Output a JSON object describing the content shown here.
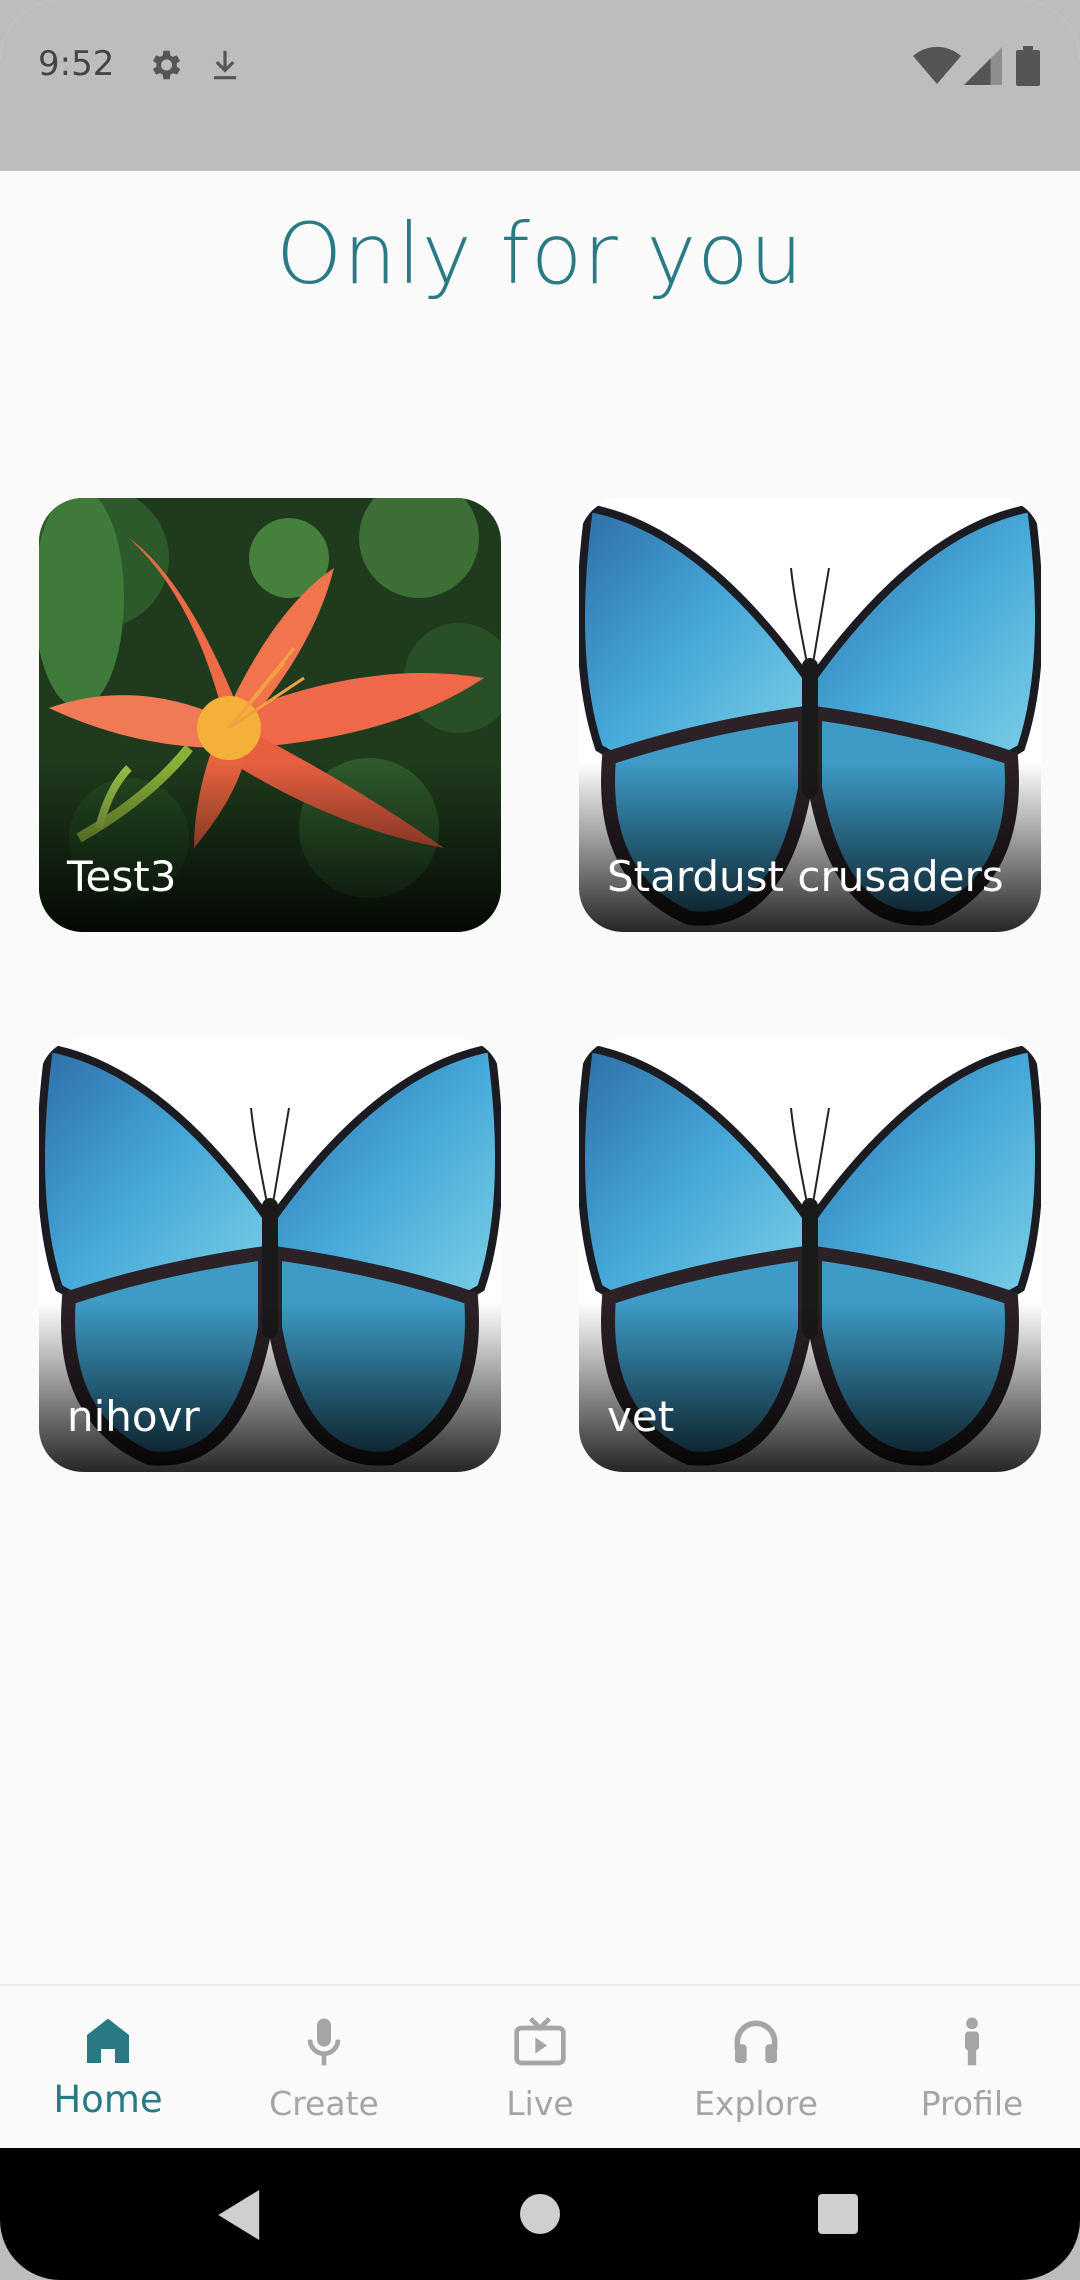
{
  "status_bar": {
    "time": "9:52",
    "icons": [
      "gear-icon",
      "download-icon",
      "wifi-icon",
      "cellular-icon",
      "battery-icon"
    ]
  },
  "page": {
    "title": "Only for you"
  },
  "cards": [
    {
      "label": "Test3",
      "image": "lily-flower"
    },
    {
      "label": "Stardust crusaders",
      "image": "blue-butterfly"
    },
    {
      "label": "nihovr",
      "image": "blue-butterfly"
    },
    {
      "label": "vet",
      "image": "blue-butterfly"
    }
  ],
  "bottom_nav": {
    "items": [
      {
        "label": "Home",
        "icon": "home-icon",
        "active": true
      },
      {
        "label": "Create",
        "icon": "microphone-icon",
        "active": false
      },
      {
        "label": "Live",
        "icon": "tv-icon",
        "active": false
      },
      {
        "label": "Explore",
        "icon": "headphones-icon",
        "active": false
      },
      {
        "label": "Profile",
        "icon": "person-icon",
        "active": false
      }
    ]
  },
  "colors": {
    "accent": "#2a7a85",
    "inactive": "#a5a5a5",
    "background": "#fafafa"
  }
}
